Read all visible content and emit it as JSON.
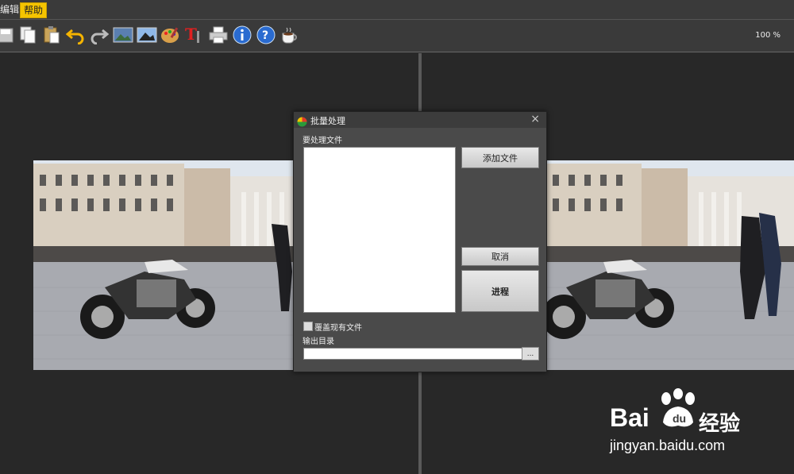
{
  "menu": {
    "edit_label": "编辑",
    "help_label": "帮助"
  },
  "toolbar": {
    "icons": [
      "save-icon",
      "copy-icon",
      "paste-icon",
      "undo-icon",
      "redo-icon",
      "image-icon",
      "picture-icon",
      "palette-icon",
      "text-tool-icon",
      "print-icon",
      "info-icon",
      "help-icon",
      "coffee-icon"
    ],
    "zoom": "100 %"
  },
  "dialog": {
    "title": "批量处理",
    "close": "×",
    "files_label": "要处理文件",
    "add_file": "添加文件",
    "cancel": "取消",
    "process": "进程",
    "overwrite_label": "覆盖现有文件",
    "output_dir_label": "输出目录",
    "output_dir_value": "",
    "browse": "..."
  },
  "watermark": {
    "brand": "Bai",
    "suffix": "经验",
    "url": "jingyan.baidu.com"
  }
}
